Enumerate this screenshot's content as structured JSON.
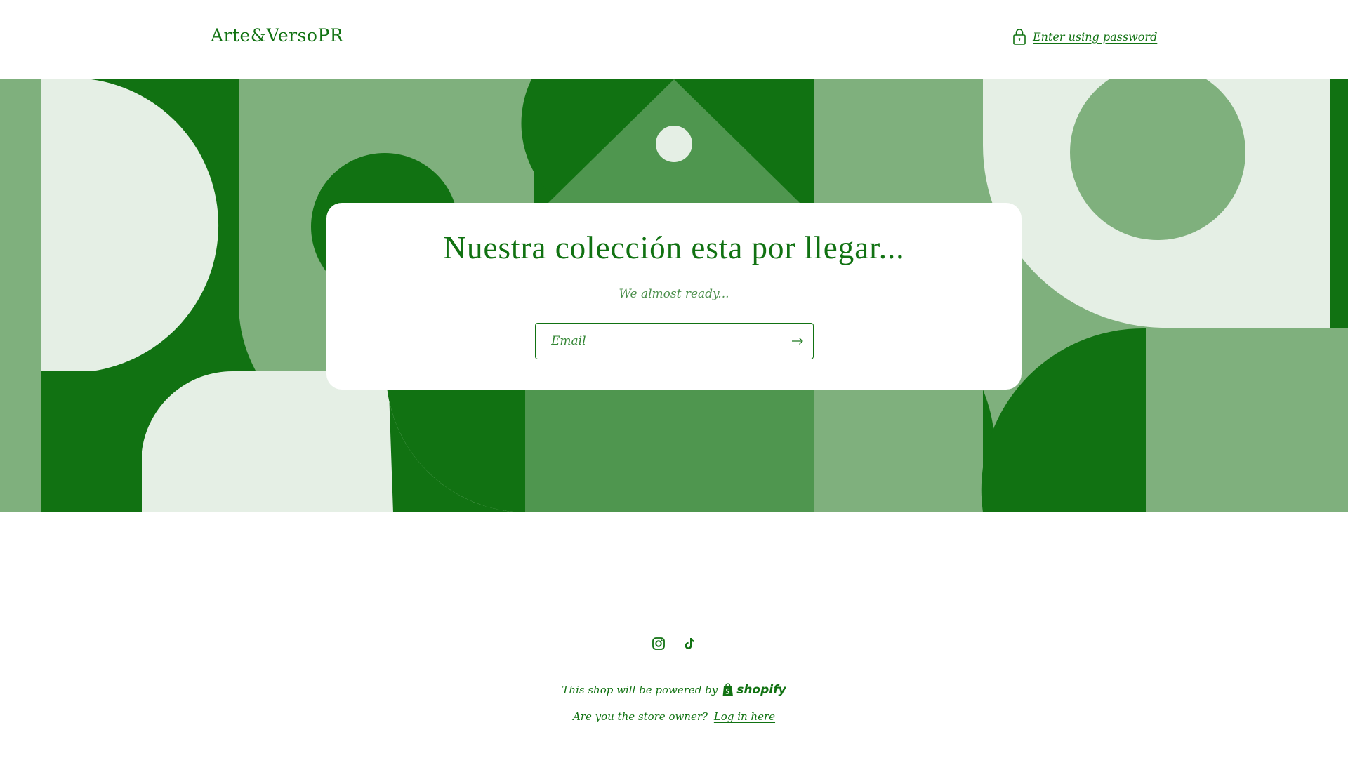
{
  "header": {
    "store_name": "Arte&VersoPR",
    "password_link": "Enter using password",
    "lock_icon": "lock-icon"
  },
  "hero": {
    "title": "Nuestra colección esta por llegar...",
    "subtitle": "We almost ready...",
    "email_placeholder": "Email",
    "email_value": "",
    "submit_icon": "arrow-right-icon",
    "palette": {
      "dark_green": "#117212",
      "mid_green": "#4f964f",
      "light_green": "#7fb07d",
      "pale_green": "#e5efe5"
    }
  },
  "footer": {
    "social_icons": [
      "instagram-icon",
      "tiktok-icon"
    ],
    "powered_text": "This shop will be powered by",
    "shopify_label": "shopify",
    "owner_question": "Are you the store owner?",
    "login_link": "Log in here"
  },
  "colors": {
    "brand": "#117212",
    "border": "#e4e4e4",
    "background": "#ffffff"
  }
}
